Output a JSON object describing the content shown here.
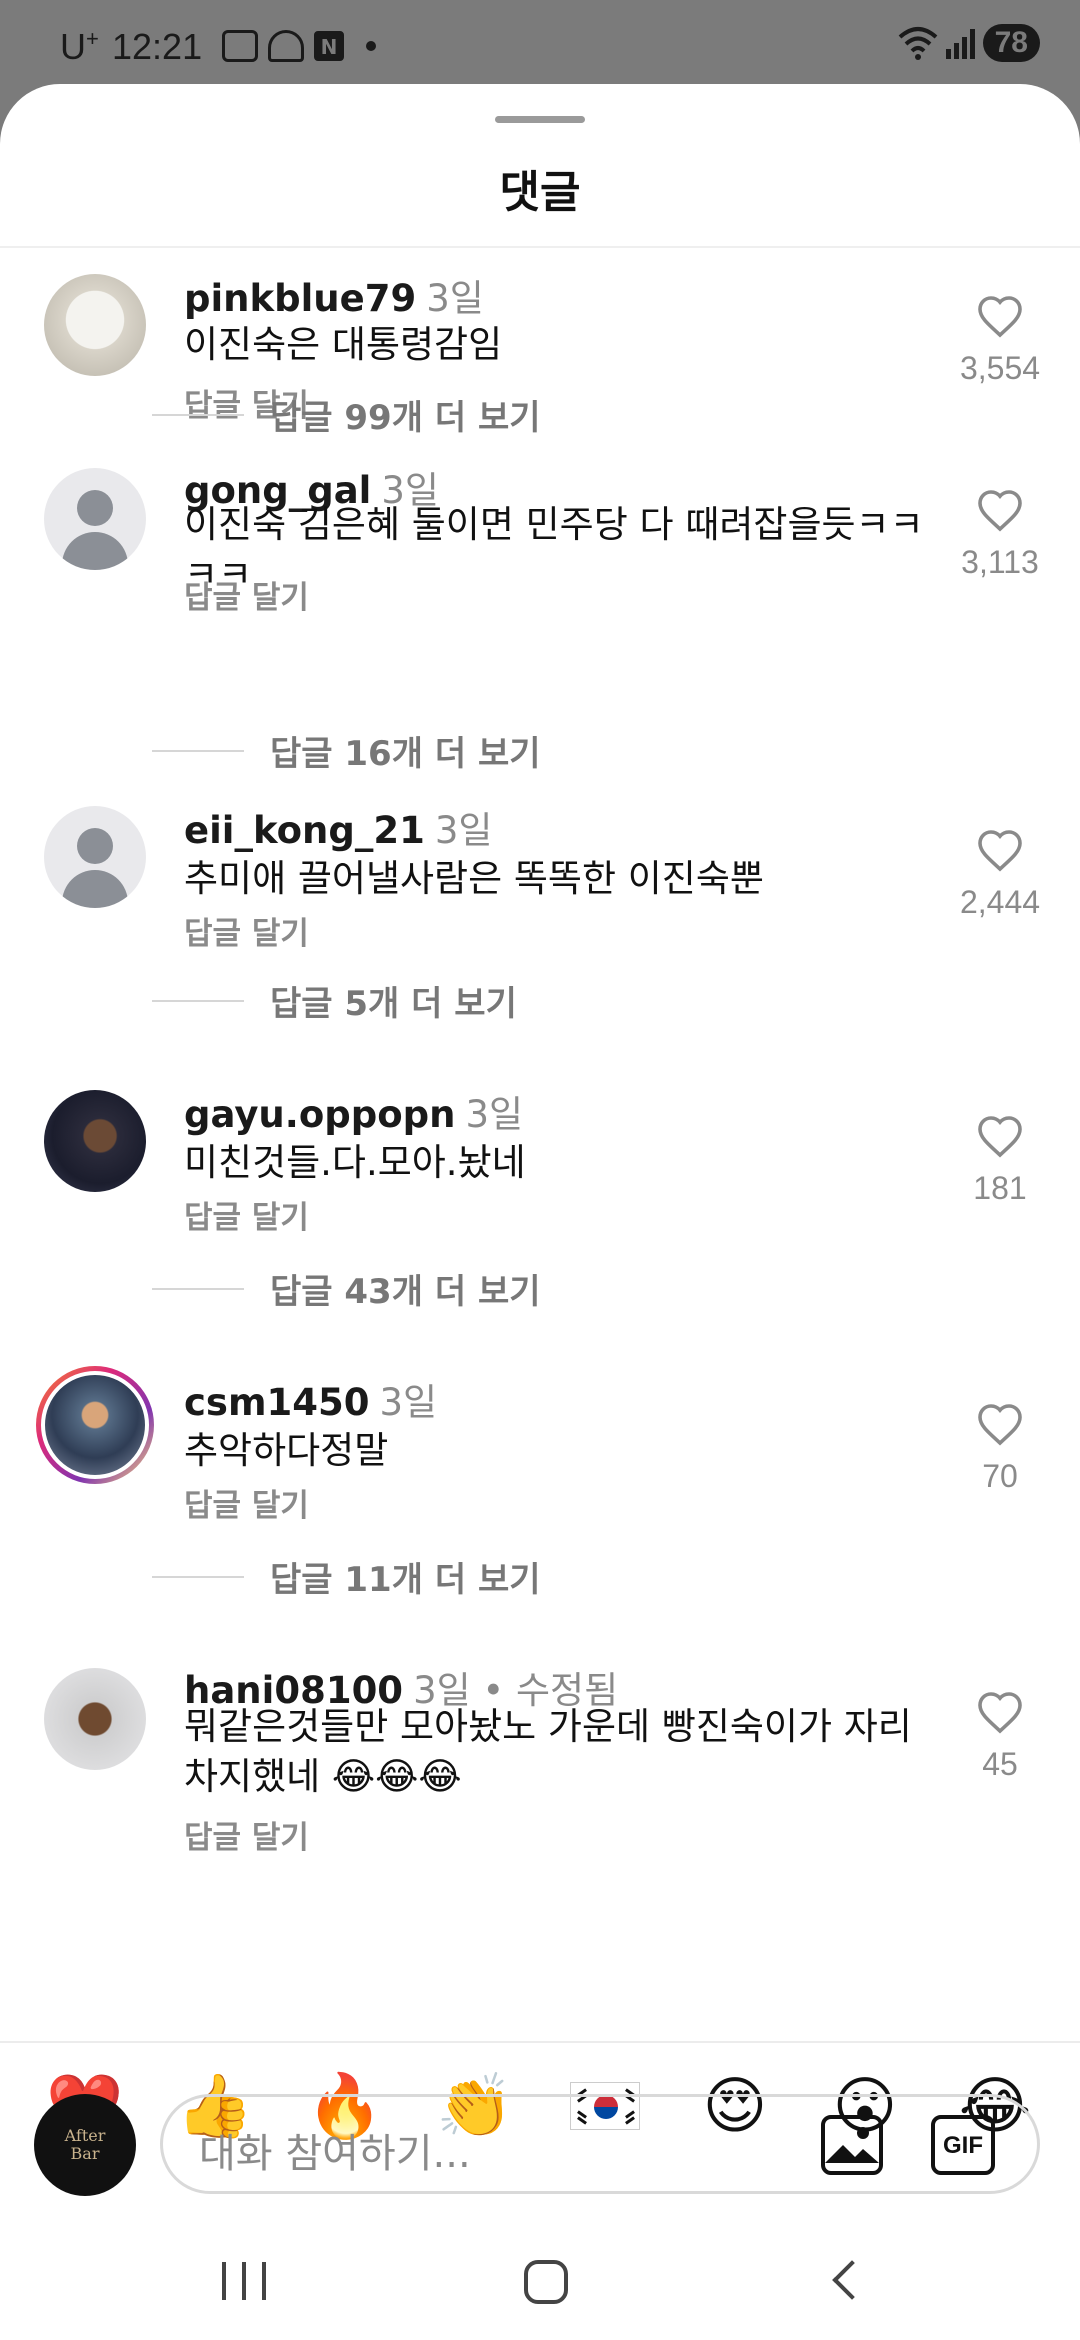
{
  "status_bar": {
    "carrier": "U",
    "carrier_sup": "+",
    "time": "12:21",
    "battery": "78",
    "icons": [
      "screenshot-icon",
      "app-icon",
      "n-icon",
      "wifi-icon",
      "signal-icon"
    ]
  },
  "sheet": {
    "title": "댓글"
  },
  "comments": [
    {
      "username": "pinkblue79",
      "meta": "3일",
      "text": "이진숙은 대통령감임",
      "reply_label": "답글 달기",
      "likes": "3,554",
      "view_replies": "답글 99개 더 보기",
      "avatar": "dog-photo"
    },
    {
      "username": "gong_gal",
      "meta": "3일",
      "text": "이진숙 김은혜 둘이면 민주당 다 때려잡을듯ㅋㅋㅋㅋ",
      "reply_label": "답글 달기",
      "likes": "3,113",
      "view_replies": "답글 16개 더 보기",
      "avatar": "default"
    },
    {
      "username": "eii_kong_21",
      "meta": "3일",
      "text": "추미애 끌어낼사람은  똑똑한 이진숙뿐",
      "reply_label": "답글 달기",
      "likes": "2,444",
      "view_replies": "답글 5개 더 보기",
      "avatar": "default"
    },
    {
      "username": "gayu.oppopn",
      "meta": "3일",
      "text": "미친것들.다.모아.놨네",
      "reply_label": "답글 달기",
      "likes": "181",
      "view_replies": "답글 43개 더 보기",
      "avatar": "person-photo"
    },
    {
      "username": "csm1450",
      "meta": "3일",
      "text": "추악하다정말",
      "reply_label": "답글 달기",
      "likes": "70",
      "view_replies": "답글 11개 더 보기",
      "avatar": "story-ring-photo"
    },
    {
      "username": "hani08100",
      "meta": "3일 • 수정됨",
      "text": "뭐같은것들만 모아놨노 가운데 빵진숙이가 자리차지했네 😂😂😂",
      "reply_label": "답글 달기",
      "likes": "45",
      "avatar": "coin-photo"
    }
  ],
  "reactions": [
    "❤️",
    "👍",
    "🔥",
    "👏",
    "🇰🇷",
    "😍",
    "😮",
    "😂"
  ],
  "input": {
    "avatar_text_line1": "After",
    "avatar_text_line2": "Bar",
    "placeholder": "대화 참여하기...",
    "gif_label": "GIF"
  },
  "colors": {
    "accent_heart": "#ff2d55",
    "text_secondary": "#8a8a8a",
    "status_bar_bg": "#7b7b7b"
  }
}
